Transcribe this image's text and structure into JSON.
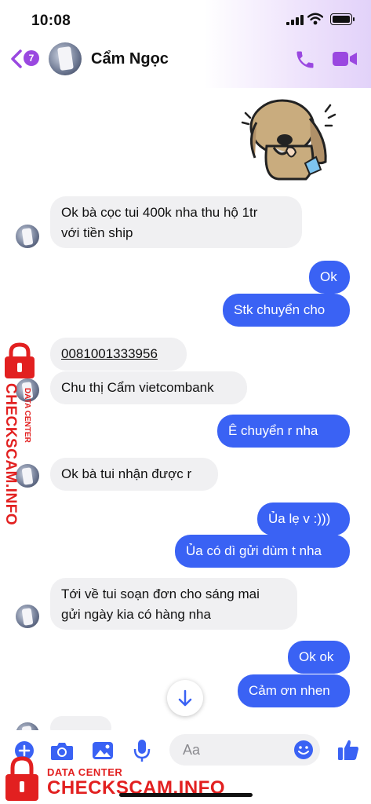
{
  "status_bar": {
    "time": "10:08"
  },
  "header": {
    "unread_count": "7",
    "contact_name": "Cẩm Ngọc"
  },
  "messages": [
    {
      "side": "in",
      "text": "Ok bà cọc tui 400k nha thu hộ 1tr",
      "text2": "với tiền ship"
    },
    {
      "side": "out",
      "text": "Ok"
    },
    {
      "side": "out",
      "text": "Stk chuyển cho"
    },
    {
      "side": "in",
      "text": "0081001333956"
    },
    {
      "side": "in",
      "text": "Chu thị Cẩm vietcombank"
    },
    {
      "side": "out",
      "text": "Ê chuyển r nha"
    },
    {
      "side": "in",
      "text": "Ok bà tui nhận được r"
    },
    {
      "side": "out",
      "text": "Ủa lẹ v :)))"
    },
    {
      "side": "out",
      "text": "Ủa có dì gửi dùm t nha"
    },
    {
      "side": "in",
      "text": "Tới về tui soạn đơn cho sáng mai",
      "text2": "gửi ngày kia có hàng nha"
    },
    {
      "side": "out",
      "text": "Ok ok"
    },
    {
      "side": "out",
      "text": "Cảm ơn nhen"
    }
  ],
  "composer": {
    "placeholder": "Aa"
  },
  "watermark": {
    "label_small": "DATA CENTER",
    "label_big": "CHECKSCAM.INFO"
  },
  "colors": {
    "accent": "#9a48e0",
    "bubble_out": "#3a62f4",
    "bubble_in": "#f0f0f2",
    "watermark": "#e22020"
  },
  "icons": [
    "back-chevron-icon",
    "phone-icon",
    "video-camera-icon",
    "sticker-crying-dog",
    "scroll-down-icon",
    "plus-icon",
    "camera-icon",
    "image-icon",
    "microphone-icon",
    "emoji-icon",
    "thumbs-up-icon",
    "lock-icon"
  ]
}
